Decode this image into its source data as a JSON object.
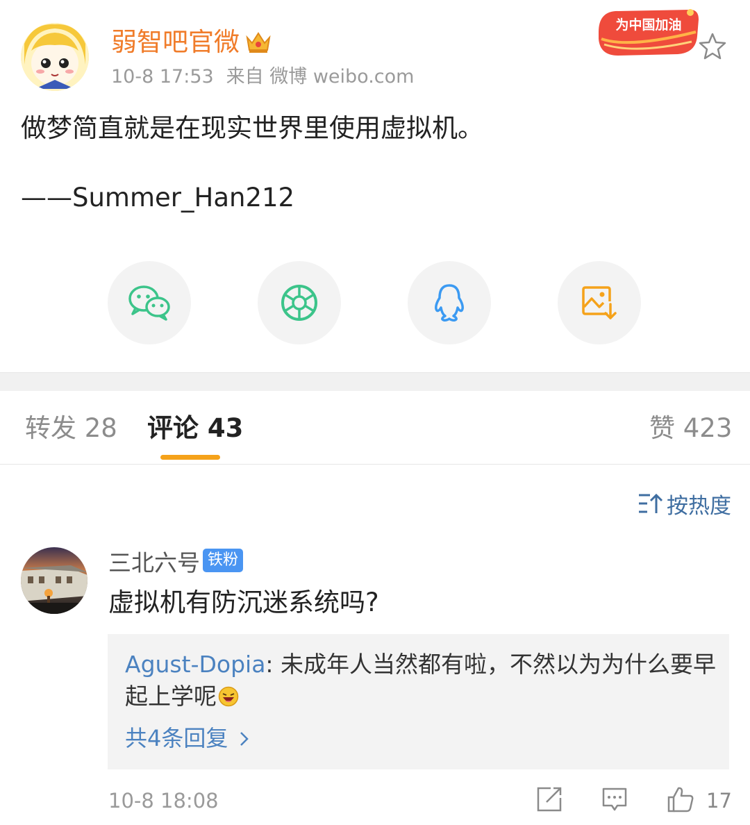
{
  "post": {
    "author": "弱智吧官微",
    "time": "10-8 17:53",
    "source": "来自 微博 weibo.com",
    "badge_text": "为中国加油",
    "text": "做梦简直就是在现实世界里使用虚拟机。",
    "attribution": "——Summer_Han212"
  },
  "share": {
    "items": [
      {
        "icon": "wechat-icon"
      },
      {
        "icon": "moments-icon"
      },
      {
        "icon": "qq-icon"
      },
      {
        "icon": "save-image-icon"
      }
    ]
  },
  "tabs": {
    "repost": "转发 28",
    "comments": "评论 43",
    "likes": "赞 423"
  },
  "sort": {
    "label": "按热度"
  },
  "comment": {
    "user": "三北六号",
    "badge": "铁粉",
    "text": "虚拟机有防沉迷系统吗?",
    "reply_user": "Agust-Dopia",
    "reply_colon": ":",
    "reply_line1": " 未成年人当然都有啦，不然以为为什么要早",
    "reply_line2": "起上学呢",
    "more_replies": "共4条回复",
    "time": "10-8 18:08",
    "like_count": "17"
  },
  "colors": {
    "accent": "#f5a21a",
    "author": "#f07c2a",
    "link": "#4b82c0",
    "badge_blue": "#4a95f2"
  }
}
